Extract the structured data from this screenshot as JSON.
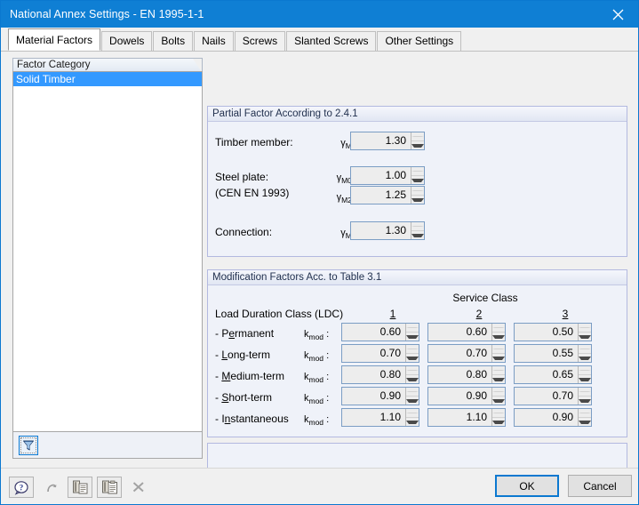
{
  "window": {
    "title": "National Annex Settings - EN 1995-1-1",
    "close_icon": "close-icon"
  },
  "tabs": [
    {
      "label": "Material Factors",
      "active": true
    },
    {
      "label": "Dowels",
      "active": false
    },
    {
      "label": "Bolts",
      "active": false
    },
    {
      "label": "Nails",
      "active": false
    },
    {
      "label": "Screws",
      "active": false
    },
    {
      "label": "Slanted Screws",
      "active": false
    },
    {
      "label": "Other Settings",
      "active": false
    }
  ],
  "factor_category": {
    "header": "Factor Category",
    "items": [
      {
        "label": "Solid Timber",
        "selected": true
      }
    ],
    "filter_icon": "filter-icon"
  },
  "partial_factor": {
    "header": "Partial Factor According to 2.4.1",
    "rows": [
      {
        "label": "Timber member:",
        "symbol": "γ",
        "subscript": "M",
        "value": "1.30"
      },
      {
        "label": "Steel plate:",
        "symbol": "γ",
        "subscript": "M0",
        "value": "1.00"
      },
      {
        "label": "(CEN EN 1993)",
        "symbol": "γ",
        "subscript": "M2",
        "value": "1.25"
      },
      {
        "label": "Connection:",
        "symbol": "γ",
        "subscript": "M",
        "value": "1.30"
      }
    ]
  },
  "modification_factors": {
    "header": "Modification Factors Acc. to Table 3.1",
    "service_class_title": "Service Class",
    "ldc_title": "Load Duration Class (LDC)",
    "service_classes": [
      "1",
      "2",
      "3"
    ],
    "symbol": "k",
    "symbol_sub": "mod",
    "rows": [
      {
        "label_pre": "- P",
        "label_mn": "e",
        "label_post": "rmanent",
        "values": [
          "0.60",
          "0.60",
          "0.50"
        ]
      },
      {
        "label_pre": "- ",
        "label_mn": "L",
        "label_post": "ong-term",
        "values": [
          "0.70",
          "0.70",
          "0.55"
        ]
      },
      {
        "label_pre": "- ",
        "label_mn": "M",
        "label_post": "edium-term",
        "values": [
          "0.80",
          "0.80",
          "0.65"
        ]
      },
      {
        "label_pre": "- ",
        "label_mn": "S",
        "label_post": "hort-term",
        "values": [
          "0.90",
          "0.90",
          "0.70"
        ]
      },
      {
        "label_pre": "- I",
        "label_mn": "n",
        "label_post": "stantaneous",
        "values": [
          "1.10",
          "1.10",
          "0.90"
        ]
      }
    ]
  },
  "toolbar": [
    {
      "icon": "help-icon",
      "enabled": true
    },
    {
      "icon": "undo-arrow-icon",
      "enabled": false
    },
    {
      "icon": "copy-icon",
      "enabled": true
    },
    {
      "icon": "paste-icon",
      "enabled": true
    },
    {
      "icon": "delete-x-icon",
      "enabled": false
    }
  ],
  "dialog_buttons": {
    "ok": "OK",
    "cancel": "Cancel"
  },
  "colors": {
    "titlebar": "#0f7fd4",
    "accent": "#0b78d0",
    "selection": "#3399ff",
    "group_border": "#b3b9e0",
    "group_bg": "#eff2f9"
  }
}
